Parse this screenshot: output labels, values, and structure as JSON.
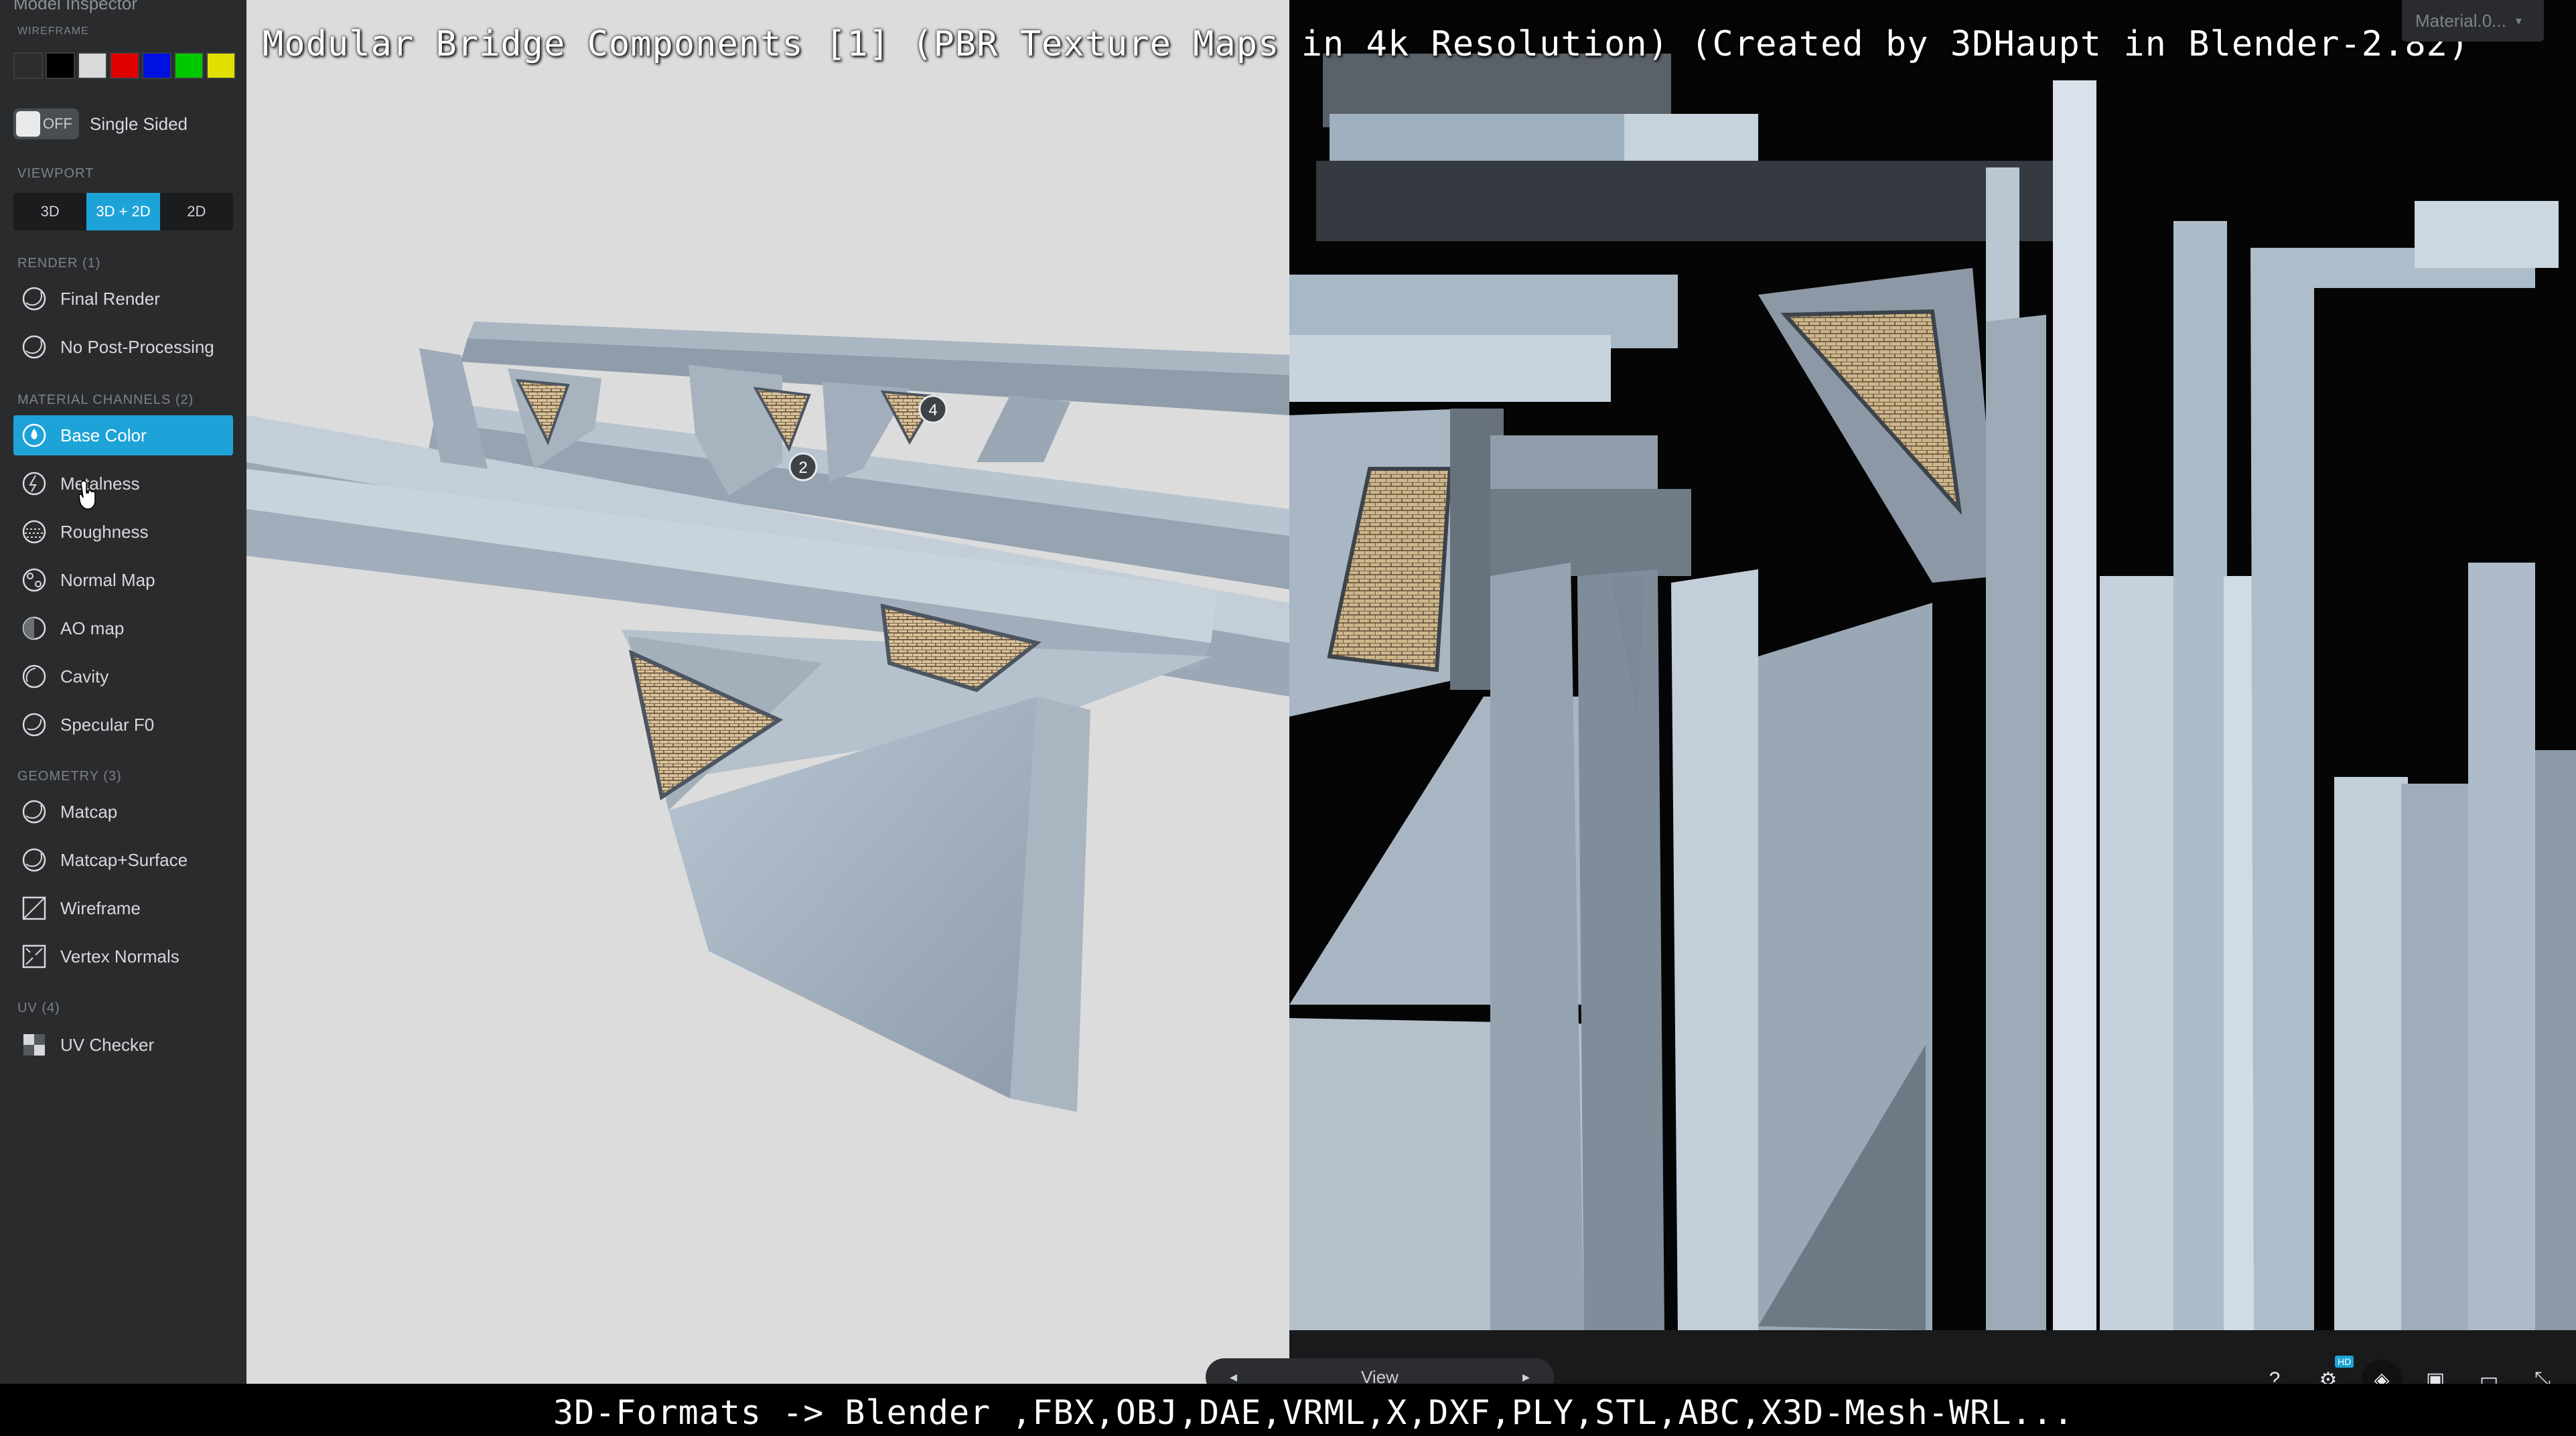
{
  "overlay": {
    "title": "Modular Bridge Components [1] (PBR Texture Maps in 4k Resolution) (Created by 3DHaupt in Blender-2.82)",
    "subtitle": "3D-Formats -> Blender ,FBX,OBJ,DAE,VRML,X,DXF,PLY,STL,ABC,X3D-Mesh-WRL..."
  },
  "sidebar": {
    "panel_title": "Model Inspector",
    "wireframe_label": "WIREFRAME",
    "wireframe_colors": [
      "#2c2c2c",
      "#000000",
      "#d9d9d9",
      "#e00000",
      "#0010e0",
      "#00c800",
      "#e0e000"
    ],
    "single_sided": {
      "state": "OFF",
      "label": "Single Sided"
    },
    "viewport": {
      "label": "VIEWPORT",
      "options": [
        "3D",
        "3D + 2D",
        "2D"
      ],
      "selected": "3D + 2D"
    },
    "render": {
      "label": "RENDER (1)",
      "items": [
        "Final Render",
        "No Post-Processing"
      ]
    },
    "material_channels": {
      "label": "MATERIAL CHANNELS (2)",
      "items": [
        "Base Color",
        "Metalness",
        "Roughness",
        "Normal Map",
        "AO map",
        "Cavity",
        "Specular F0"
      ],
      "active": "Base Color"
    },
    "geometry": {
      "label": "GEOMETRY (3)",
      "items": [
        "Matcap",
        "Matcap+Surface",
        "Wireframe",
        "Vertex Normals"
      ]
    },
    "uv": {
      "label": "UV (4)",
      "items": [
        "UV Checker"
      ]
    }
  },
  "viewport3d": {
    "annotations": [
      "2",
      "4"
    ]
  },
  "material_select": {
    "value": "Material.0..."
  },
  "viewbar": {
    "label": "View"
  },
  "toolbar": {
    "help_label": "?",
    "hd_badge": "HD"
  },
  "accent_color": "#1ea3d8"
}
